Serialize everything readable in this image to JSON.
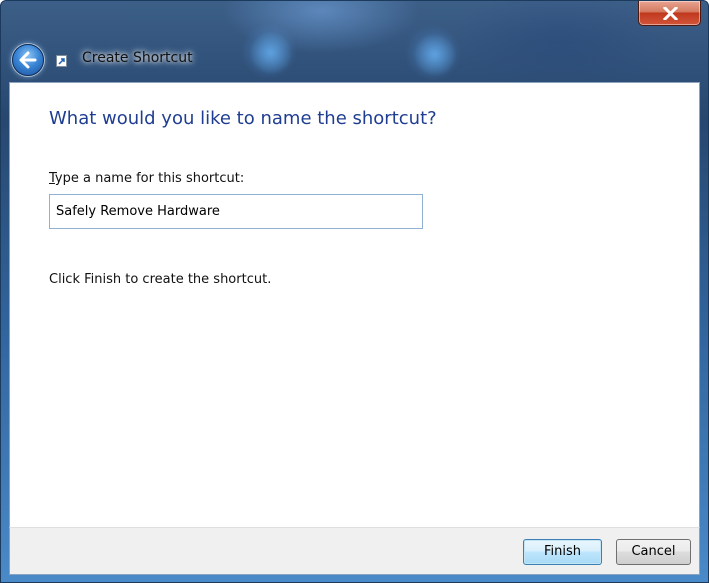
{
  "window": {
    "title": "Create Shortcut",
    "close_icon": "close-icon",
    "back_icon": "back-arrow-icon",
    "title_icon": "shortcut-icon",
    "colors": {
      "heading": "#1f3e91",
      "close_button": "#c0391f",
      "frame": "#31639b"
    }
  },
  "page": {
    "heading": "What would you like to name the shortcut?",
    "field_label_accel": "T",
    "field_label_rest": "ype a name for this shortcut:",
    "name_value": "Safely Remove Hardware",
    "instructions": "Click Finish to create the shortcut."
  },
  "footer": {
    "finish_label": "Finish",
    "cancel_label": "Cancel"
  }
}
